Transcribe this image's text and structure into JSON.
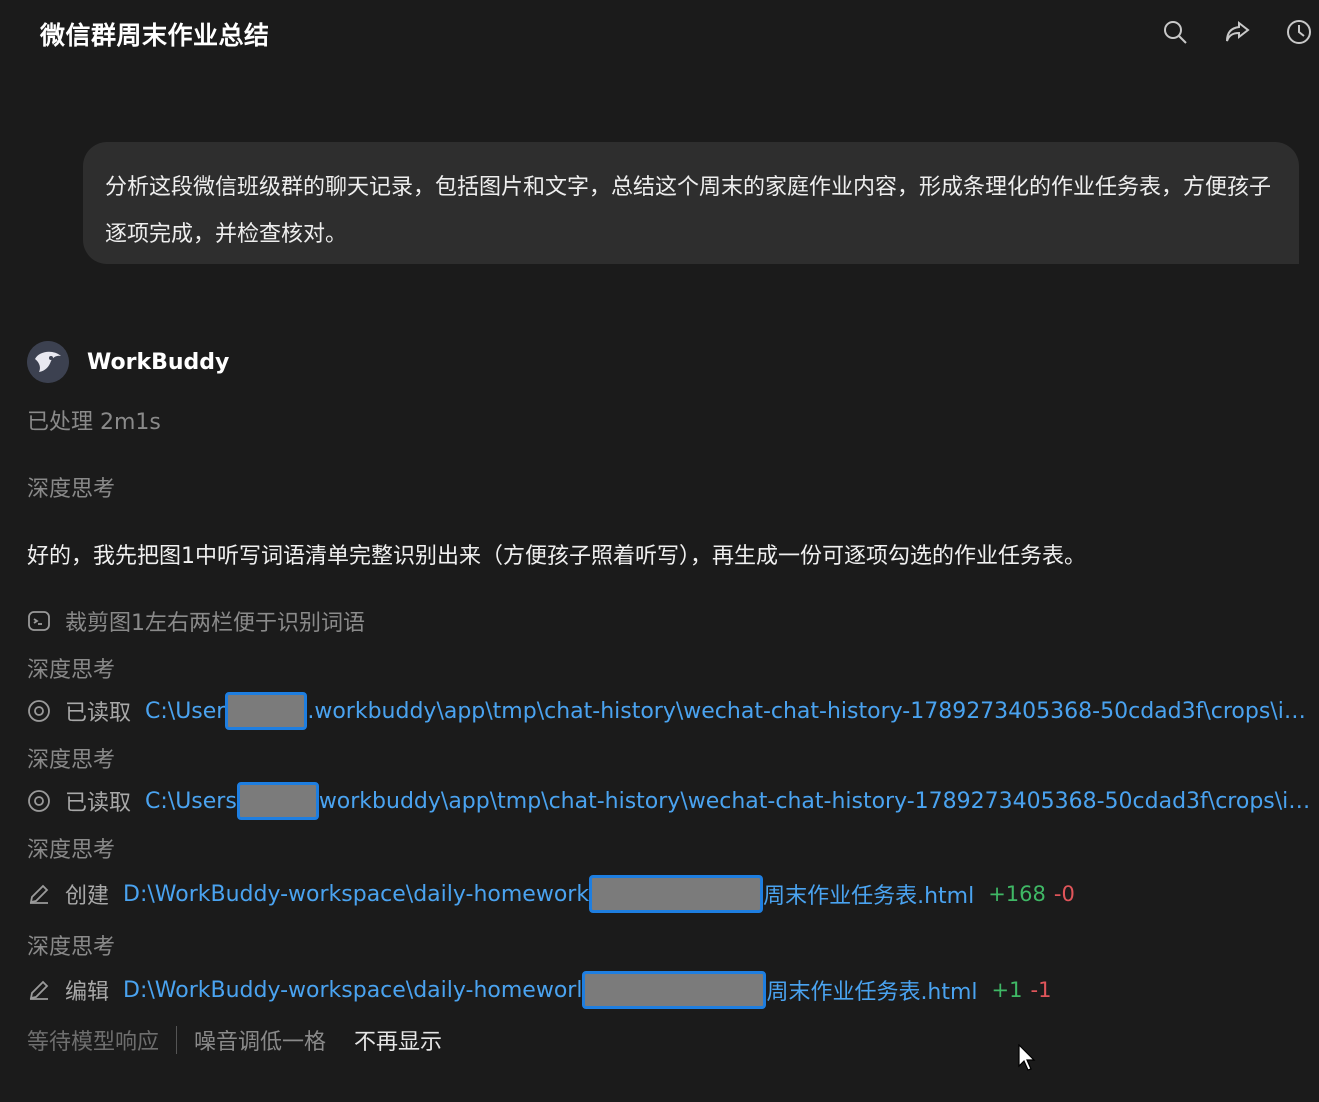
{
  "header": {
    "title": "微信群周末作业总结",
    "icons": [
      "search-icon",
      "share-icon",
      "history-icon"
    ]
  },
  "user_message": {
    "text": "分析这段微信班级群的聊天记录，包括图片和文字，总结这个周末的家庭作业内容，形成条理化的作业任务表，方便孩子逐项完成，并检查核对。"
  },
  "assistant": {
    "name": "WorkBuddy",
    "processed": "已处理 2m1s",
    "thinking_label": "深度思考",
    "reply": "好的，我先把图1中听写词语清单完整识别出来（方便孩子照着听写），再生成一份可逐项勾选的作业任务表。",
    "steps": [
      {
        "icon": "terminal-icon",
        "verb": "",
        "text": "裁剪图1左右两栏便于识别词语"
      },
      {
        "icon": "eye-icon",
        "verb": "已读取",
        "path_prefix": "C:\\User",
        "path_suffix": ".workbuddy\\app\\tmp\\chat-history\\wechat-chat-history-1789273405368-50cdad3f\\crops\\i…"
      },
      {
        "icon": "eye-icon",
        "verb": "已读取",
        "path_prefix": "C:\\Users",
        "path_suffix": "workbuddy\\app\\tmp\\chat-history\\wechat-chat-history-1789273405368-50cdad3f\\crops\\i…"
      },
      {
        "icon": "pencil-icon",
        "verb": "创建",
        "path_prefix": "D:\\WorkBuddy-workspace\\daily-homework",
        "path_suffix": "周末作业任务表.html",
        "added": "+168",
        "removed": "-0"
      },
      {
        "icon": "pencil-icon",
        "verb": "编辑",
        "path_prefix": "D:\\WorkBuddy-workspace\\daily-homeworl",
        "path_suffix": "周末作业任务表.html",
        "added": "+1",
        "removed": "-1"
      }
    ]
  },
  "status_bar": {
    "waiting": "等待模型响应",
    "hint": "噪音调低一格",
    "dismiss": "不再显示"
  },
  "colors": {
    "background": "#1b1b1b",
    "bubble": "#2e2e2e",
    "link": "#4aa3f0",
    "added": "#3fb865",
    "removed": "#e0555a",
    "redact_border": "#1e7ee0"
  }
}
